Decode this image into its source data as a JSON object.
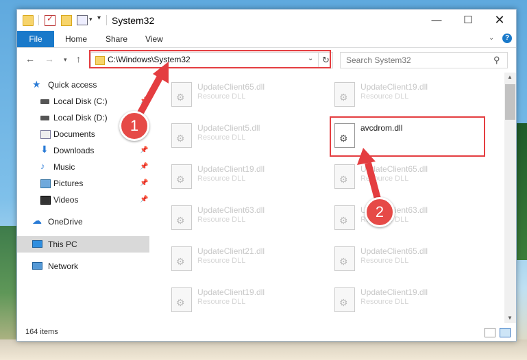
{
  "window": {
    "title": "System32"
  },
  "ribbon": {
    "file": "File",
    "home": "Home",
    "share": "Share",
    "view": "View",
    "help": "?"
  },
  "address": {
    "path": "C:\\Windows\\System32"
  },
  "search": {
    "placeholder": "Search System32"
  },
  "sidebar": {
    "items": [
      {
        "label": "Quick access",
        "icon": "star-icon"
      },
      {
        "label": "Local Disk (C:)",
        "icon": "drive-icon"
      },
      {
        "label": "Local Disk (D:)",
        "icon": "drive-icon"
      },
      {
        "label": "Documents",
        "icon": "documents-icon"
      },
      {
        "label": "Downloads",
        "icon": "downloads-icon"
      },
      {
        "label": "Music",
        "icon": "music-icon"
      },
      {
        "label": "Pictures",
        "icon": "pictures-icon"
      },
      {
        "label": "Videos",
        "icon": "videos-icon"
      },
      {
        "label": "OneDrive",
        "icon": "cloud-icon"
      },
      {
        "label": "This PC",
        "icon": "pc-icon",
        "selected": true
      },
      {
        "label": "Network",
        "icon": "network-icon"
      }
    ]
  },
  "files": {
    "left": [
      {
        "name": "UpdateClient65.dll",
        "type": "Resource DLL"
      },
      {
        "name": "UpdateClient5.dll",
        "type": "Resource DLL"
      },
      {
        "name": "UpdateClient19.dll",
        "type": "Resource DLL"
      },
      {
        "name": "UpdateClient63.dll",
        "type": "Resource DLL"
      },
      {
        "name": "UpdateClient21.dll",
        "type": "Resource DLL"
      },
      {
        "name": "UpdateClient19.dll",
        "type": "Resource DLL"
      }
    ],
    "right": [
      {
        "name": "UpdateClient19.dll",
        "type": "Resource DLL"
      },
      {
        "name": "avcdrom.dll",
        "type": ""
      },
      {
        "name": "UpdateClient65.dll",
        "type": "Resource DLL"
      },
      {
        "name": "UpdateClient63.dll",
        "type": "Resource DLL"
      },
      {
        "name": "UpdateClient65.dll",
        "type": "Resource DLL"
      },
      {
        "name": "UpdateClient19.dll",
        "type": "Resource DLL"
      }
    ]
  },
  "status": {
    "items": "164 items"
  },
  "annotations": {
    "step1": "1",
    "step2": "2",
    "color": "#e43d40"
  }
}
